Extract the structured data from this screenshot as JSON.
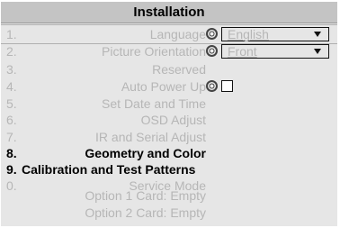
{
  "window": {
    "title": "Installation"
  },
  "menu": {
    "items": [
      {
        "num": "1.",
        "label": "Language",
        "control": "dropdown",
        "value": "English"
      },
      {
        "num": "2.",
        "label": "Picture Orientation",
        "control": "dropdown",
        "value": "Front"
      },
      {
        "num": "3.",
        "label": "Reserved"
      },
      {
        "num": "4.",
        "label": "Auto Power Up",
        "control": "checkbox",
        "checked": false
      },
      {
        "num": "5.",
        "label": "Set Date and Time"
      },
      {
        "num": "6.",
        "label": "OSD Adjust"
      },
      {
        "num": "7.",
        "label": "IR and Serial Adjust"
      },
      {
        "num": "8.",
        "label": "Geometry and Color"
      },
      {
        "num": "9.",
        "label": "Calibration and Test Patterns"
      },
      {
        "num": "0.",
        "label": "Service Mode"
      },
      {
        "num": "",
        "label": "Option 1 Card: Empty"
      },
      {
        "num": "",
        "label": "Option 2 Card: Empty"
      }
    ]
  },
  "colors": {
    "title_bar": "#c4c4c4",
    "background": "#e6e6e6",
    "disabled_text": "#b6b6b6",
    "active_text": "#000000"
  },
  "icons": {
    "lock": "gear-lock-icon",
    "dropdown_arrow": "triangle-down"
  }
}
